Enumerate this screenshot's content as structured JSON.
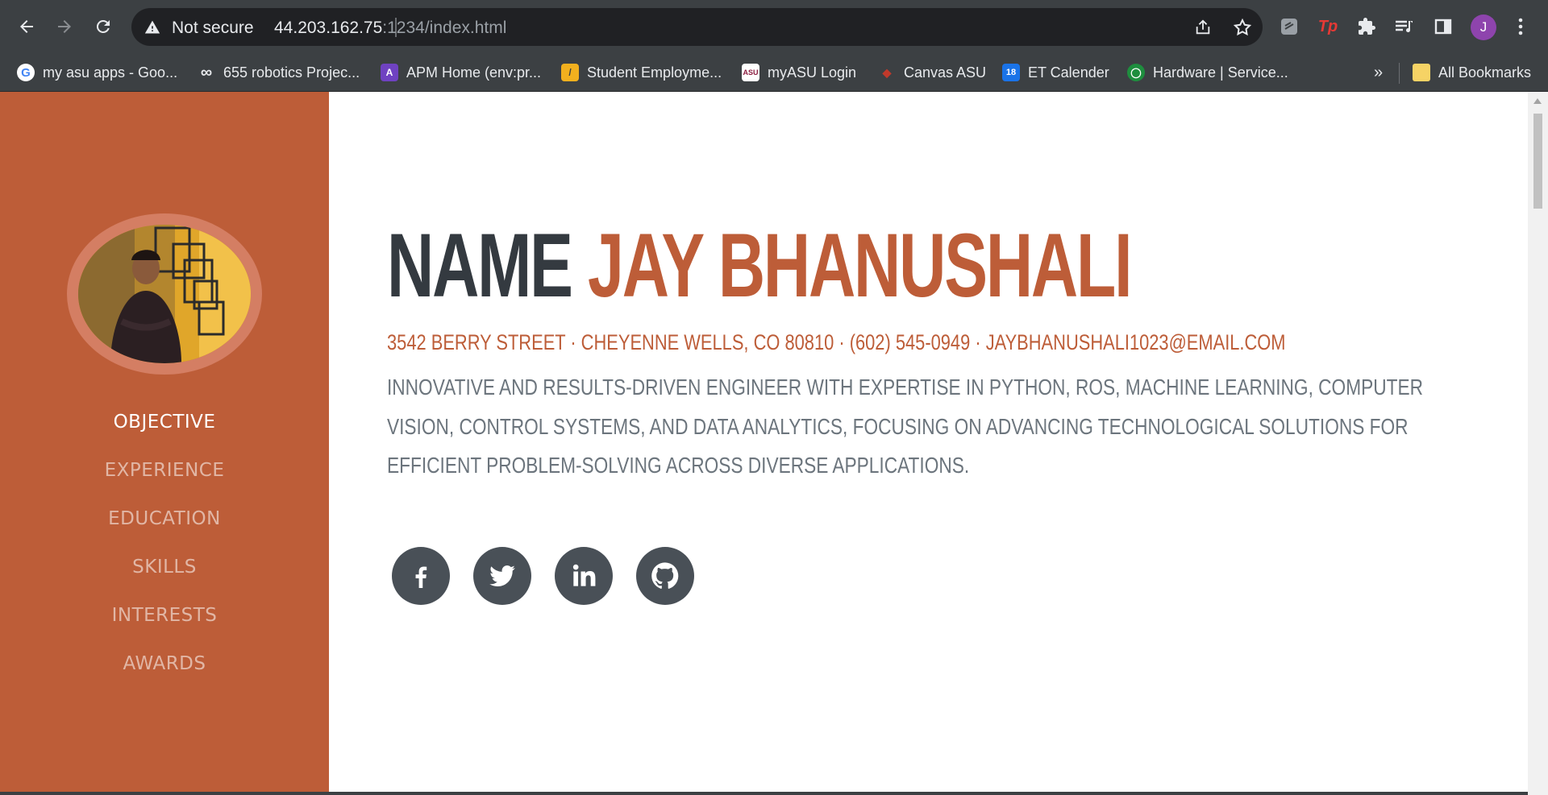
{
  "browser": {
    "security_label": "Not secure",
    "url_host": "44.203.162.75",
    "url_path": ":1234/index.html",
    "avatar_initial": "J",
    "bookmarks": [
      {
        "label": "my asu apps - Goo...",
        "icon": "google-icon",
        "color": "#ffffff"
      },
      {
        "label": "655 robotics Projec...",
        "icon": "infinity-icon",
        "color": "#3c4043"
      },
      {
        "label": "APM Home (env:pr...",
        "icon": "apm-icon",
        "color": "#6f42c1"
      },
      {
        "label": "Student Employme...",
        "icon": "employment-icon",
        "color": "#f2b01e"
      },
      {
        "label": "myASU Login",
        "icon": "asu-icon",
        "color": "#8c1d40"
      },
      {
        "label": "Canvas ASU",
        "icon": "canvas-icon",
        "color": "#8c1d40"
      },
      {
        "label": "ET Calender",
        "icon": "calendar-icon",
        "color": "#1a73e8"
      },
      {
        "label": "Hardware | Service...",
        "icon": "hardware-icon",
        "color": "#1e8e3e"
      }
    ],
    "overflow_label": "»",
    "all_bookmarks_label": "All Bookmarks"
  },
  "sidebar": {
    "nav": [
      {
        "label": "OBJECTIVE",
        "active": true
      },
      {
        "label": "EXPERIENCE",
        "active": false
      },
      {
        "label": "EDUCATION",
        "active": false
      },
      {
        "label": "SKILLS",
        "active": false
      },
      {
        "label": "INTERESTS",
        "active": false
      },
      {
        "label": "AWARDS",
        "active": false
      }
    ]
  },
  "hero": {
    "first": "NAME",
    "last": "JAY BHANUSHALI",
    "address": "3542 BERRY STREET · CHEYENNE WELLS, CO 80810 · (602) 545-0949 · JAYBHANUSHALI1023@EMAIL.COM",
    "objective": "INNOVATIVE AND RESULTS-DRIVEN ENGINEER WITH EXPERTISE IN PYTHON, ROS, MACHINE LEARNING, COMPUTER VISION, CONTROL SYSTEMS, AND DATA ANALYTICS, FOCUSING ON ADVANCING TECHNOLOGICAL SOLUTIONS FOR EFFICIENT PROBLEM-SOLVING ACROSS DIVERSE APPLICATIONS."
  },
  "socials": [
    "facebook-icon",
    "twitter-icon",
    "linkedin-icon",
    "github-icon"
  ],
  "colors": {
    "accent": "#bd5d38",
    "dark": "#343a40",
    "muted": "#6c757d",
    "social_bg": "#495057"
  }
}
